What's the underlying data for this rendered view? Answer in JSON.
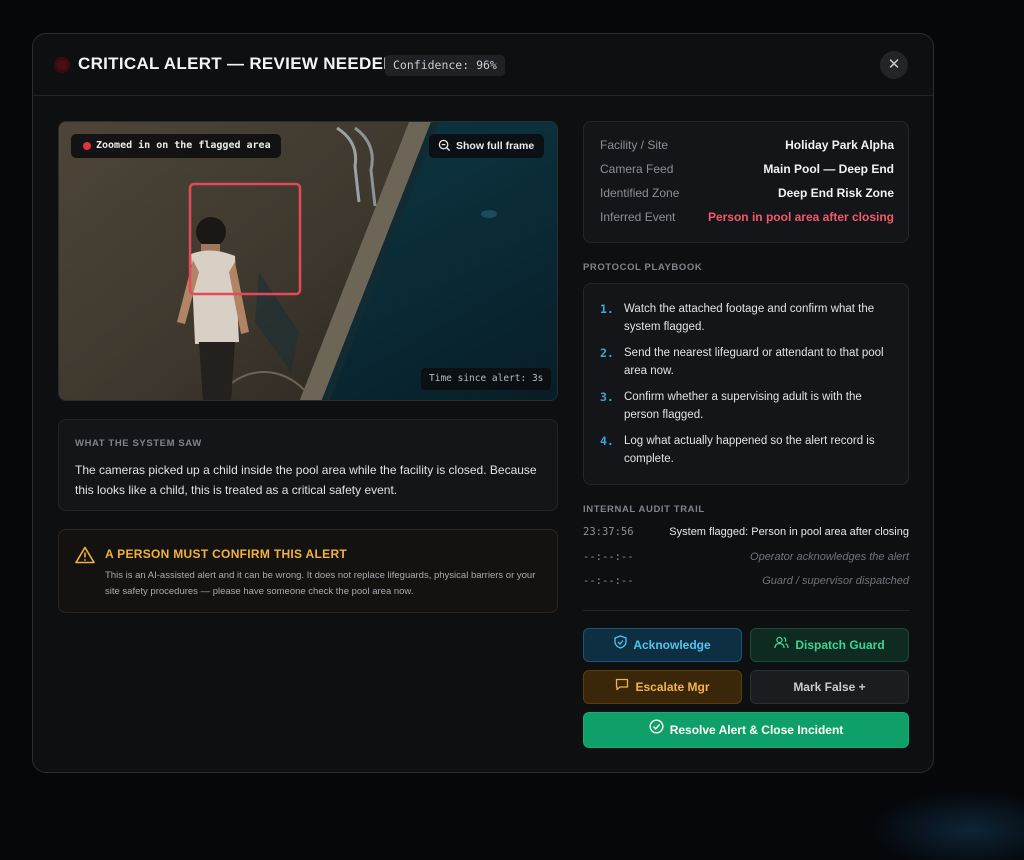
{
  "header": {
    "title": "CRITICAL ALERT — REVIEW NEEDED",
    "confidence": "Confidence: 96%",
    "close_symbol": "✕"
  },
  "video": {
    "zoom_chip": "Zoomed in on the flagged area",
    "full_frame_label": "Show full frame",
    "time_since": "Time since alert: 3s"
  },
  "system_saw": {
    "label": "WHAT THE SYSTEM SAW",
    "text": "The cameras picked up a child inside the pool area while the facility is closed. Because this looks like a child, this is treated as a critical safety event."
  },
  "warning": {
    "title": "A PERSON MUST CONFIRM THIS ALERT",
    "body": "This is an AI-assisted alert and it can be wrong. It does not replace lifeguards, physical barriers or your site safety procedures — please have someone check the pool area now."
  },
  "facts": [
    {
      "key": "Facility / Site",
      "value": "Holiday Park Alpha"
    },
    {
      "key": "Camera Feed",
      "value": "Main Pool — Deep End"
    },
    {
      "key": "Identified Zone",
      "value": "Deep End Risk Zone"
    },
    {
      "key": "Inferred Event",
      "value": "Person in pool area after closing"
    }
  ],
  "playbook": {
    "label": "PROTOCOL PLAYBOOK",
    "steps": [
      {
        "n": "1.",
        "text": "Watch the attached footage and confirm what the system flagged."
      },
      {
        "n": "2.",
        "text": "Send the nearest lifeguard or attendant to that pool area now."
      },
      {
        "n": "3.",
        "text": "Confirm whether a supervising adult is with the person flagged."
      },
      {
        "n": "4.",
        "text": "Log what actually happened so the alert record is complete."
      }
    ]
  },
  "audit": {
    "label": "INTERNAL AUDIT TRAIL",
    "rows": [
      {
        "time": "23:37:56",
        "event": "System flagged: Person in pool area after closing"
      },
      {
        "time": "--:--:--",
        "event": "Operator acknowledges the alert"
      },
      {
        "time": "--:--:--",
        "event": "Guard / supervisor dispatched"
      }
    ]
  },
  "actions": {
    "acknowledge": "Acknowledge",
    "dispatch": "Dispatch Guard",
    "escalate": "Escalate Mgr",
    "mark_false": "Mark False +",
    "resolve": "Resolve Alert & Close Incident"
  },
  "colors": {
    "critical": "#f2596a",
    "info": "#55c3ee",
    "success": "#3fd494",
    "warning": "#f2b44a",
    "resolve": "#0fa06a"
  },
  "icons": [
    "close-icon",
    "zoom-out-icon",
    "warning-triangle-icon",
    "shield-check-icon",
    "users-icon",
    "message-square-icon",
    "check-circle-icon"
  ]
}
